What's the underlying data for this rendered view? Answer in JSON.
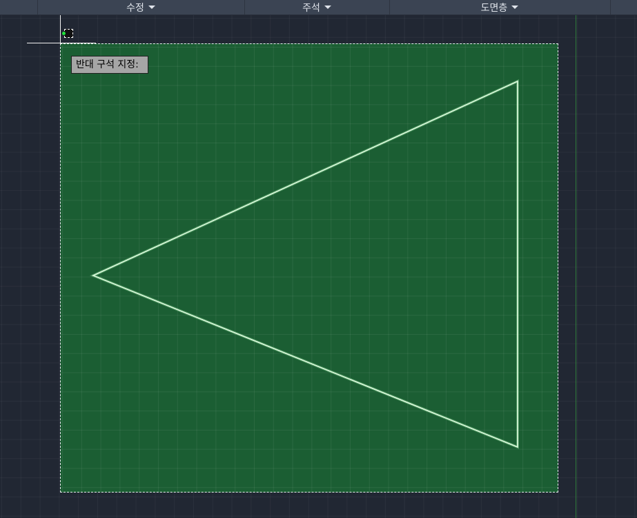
{
  "ribbon": {
    "panels": [
      {
        "label": "수정"
      },
      {
        "label": "주석"
      },
      {
        "label": "도면층"
      }
    ]
  },
  "command": {
    "prompt": "반대 구석 지정:"
  },
  "colors": {
    "background": "#212733",
    "selection_fill": "#1b5e33",
    "selection_border": "#e8eef0",
    "triangle_stroke": "#c8f2cc",
    "y_axis": "#2f7a3a",
    "tooltip_bg": "#a6a6a6"
  }
}
